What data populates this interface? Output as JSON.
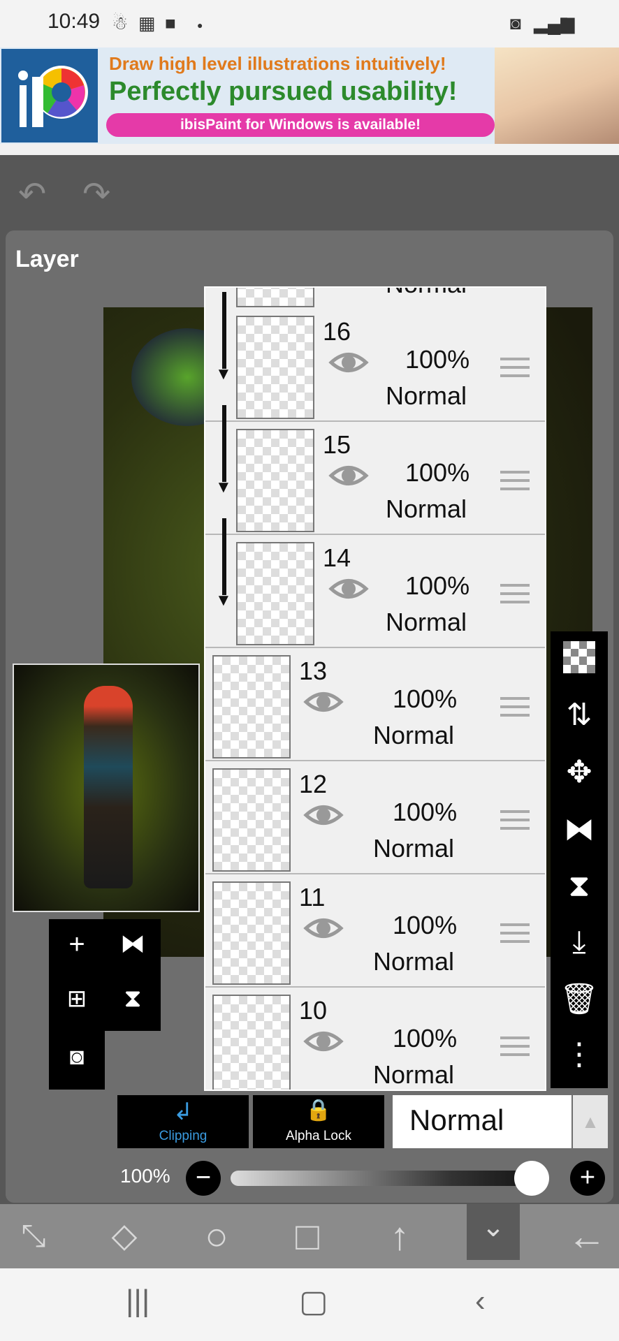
{
  "status_bar": {
    "time": "10:49",
    "left_icons": [
      "accessibility-icon",
      "calendar-icon",
      "chat-icon",
      "dot-icon"
    ],
    "right_icons": [
      "data-saver-icon",
      "signal-icon",
      "battery-icon"
    ]
  },
  "ad_banner": {
    "line1": "Draw high level illustrations intuitively!",
    "line2": "Perfectly pursued usability!",
    "pill": "ibisPaint for Windows is available!"
  },
  "header": {
    "undo_icon": "undo-icon",
    "redo_icon": "redo-icon"
  },
  "panel": {
    "title": "Layer"
  },
  "layers": [
    {
      "number": "16",
      "opacity": "100%",
      "blend": "Normal",
      "clipped": true
    },
    {
      "number": "15",
      "opacity": "100%",
      "blend": "Normal",
      "clipped": true
    },
    {
      "number": "14",
      "opacity": "100%",
      "blend": "Normal",
      "clipped": true
    },
    {
      "number": "13",
      "opacity": "100%",
      "blend": "Normal",
      "clipped": false
    },
    {
      "number": "12",
      "opacity": "100%",
      "blend": "Normal",
      "clipped": false
    },
    {
      "number": "11",
      "opacity": "100%",
      "blend": "Normal",
      "clipped": false
    },
    {
      "number": "10",
      "opacity": "100%",
      "blend": "Normal",
      "clipped": false
    }
  ],
  "top_partial_blend": "Normal",
  "right_toolbar": [
    "transparent-fill-icon",
    "swap-layers-icon",
    "move-icon",
    "flip-horizontal-icon",
    "flip-vertical-icon",
    "merge-down-icon",
    "trash-icon",
    "more-icon"
  ],
  "left_tools": {
    "add": "+",
    "add_icon": "add-layer-icon",
    "copy_icon": "duplicate-layer-icon",
    "camera_icon": "camera-icon",
    "flip_h_icon": "flip-horizontal-icon",
    "flip_v_icon": "flip-vertical-icon"
  },
  "controls": {
    "clipping_label": "Clipping",
    "alpha_lock_label": "Alpha Lock",
    "blend_mode": "Normal",
    "opacity_label": "100%",
    "opacity_value": 1.0
  },
  "bottom_tools": [
    "transform-icon",
    "eraser-icon",
    "ellipse-icon",
    "rectangle-icon",
    "arrow-up-icon",
    "collapse-icon",
    "back-arrow-icon"
  ],
  "nav": {
    "recent": "recent-apps-icon",
    "home": "home-icon",
    "back": "back-icon"
  },
  "colors": {
    "accent_blue": "#3a9be0",
    "ad_pink": "#e53aa8",
    "ad_green": "#2c8a2c",
    "panel": "#6e6e6e"
  }
}
